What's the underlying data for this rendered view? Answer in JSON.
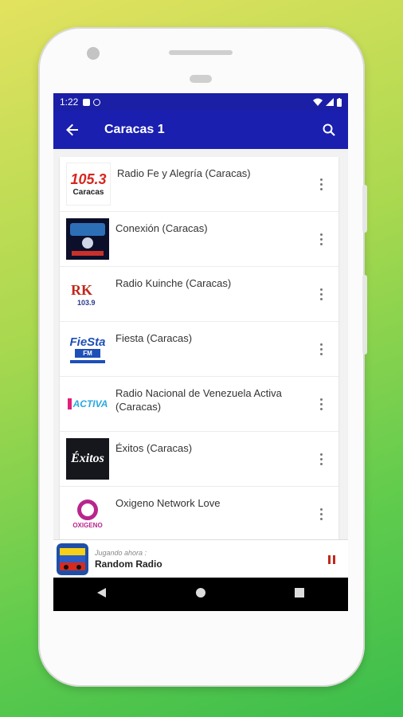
{
  "status": {
    "time": "1:22"
  },
  "appbar": {
    "title": "Caracas 1"
  },
  "stations": [
    {
      "name": "Radio Fe y Alegría (Caracas)",
      "logo_text": "105.3",
      "logo_sub": "Caracas"
    },
    {
      "name": "Conexión (Caracas)"
    },
    {
      "name": "Radio Kuinche (Caracas)",
      "logo_text": "RK",
      "logo_sub": "103.9"
    },
    {
      "name": "Fiesta (Caracas)",
      "logo_text": "FieSta",
      "logo_sub": "FM"
    },
    {
      "name": "Radio Nacional de Venezuela Activa (Caracas)",
      "logo_text": "ACTIVA"
    },
    {
      "name": "Éxitos (Caracas)",
      "logo_text": "Éxitos"
    },
    {
      "name": "Oxigeno Network Love",
      "logo_text": "OXIGENO"
    }
  ],
  "player": {
    "label": "Jugando ahora :",
    "station": "Random Radio"
  },
  "colors": {
    "appbar": "#1a1fb0",
    "statusbar": "#1a1fa5",
    "pause": "#c0281c"
  }
}
